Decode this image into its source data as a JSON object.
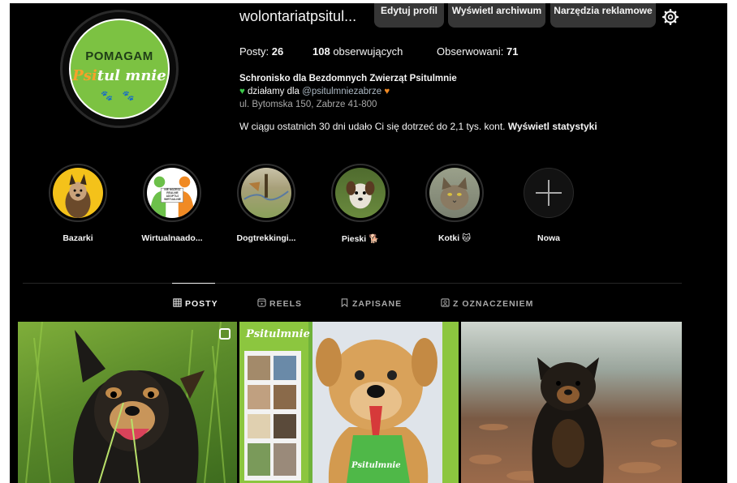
{
  "profile": {
    "username": "wolontariatpsitul...",
    "avatar_text_top": "POMAGAM",
    "avatar_text_ps": "Psi",
    "avatar_text_rest": "tul mnie",
    "buttons": {
      "edit": "Edytuj profil",
      "archive": "Wyświetl archiwum",
      "ads": "Narzędzia reklamowe"
    },
    "stats": {
      "posts_label": "Posty:",
      "posts_value": "26",
      "followers_value": "108",
      "followers_label": "obserwujących",
      "following_label": "Obserwowani:",
      "following_value": "71"
    },
    "bio": {
      "name": "Schronisko dla Bezdomnych Zwierząt Psitulmnie",
      "line2_prefix": "działamy dla",
      "mention": "@psitulmniezabrze",
      "address": "ul. Bytomska 150, Zabrze 41-800"
    },
    "reach_text": "W ciągu ostatnich 30 dni udało Ci się dotrzeć do 2,1 tys. kont.",
    "reach_link": "Wyświetl statystyki"
  },
  "highlights": [
    {
      "label": "Bazarki"
    },
    {
      "label": "Wirtualnaado..."
    },
    {
      "label": "Dogtrekkingi..."
    },
    {
      "label": "Pieski 🐕"
    },
    {
      "label": "Kotki 🐱"
    },
    {
      "label": "Nowa"
    }
  ],
  "highlight_badge_text": "NIE MOŻESZ REALNIE ADOPTUJ WIRTUALNIE",
  "tabs": [
    {
      "label": "POSTY",
      "active": true
    },
    {
      "label": "REELS",
      "active": false
    },
    {
      "label": "ZAPISANE",
      "active": false
    },
    {
      "label": "Z OZNACZENIEM",
      "active": false
    }
  ],
  "post_banner_text": "Psitulmnie",
  "post_shirt_text": "Psitulmnie",
  "colors": {
    "background": "#000000",
    "button": "#363636",
    "text": "#f5f5f5",
    "secondary_text": "#a8a8a8",
    "logo_green": "#7cc242",
    "logo_orange": "#f7a12a"
  }
}
